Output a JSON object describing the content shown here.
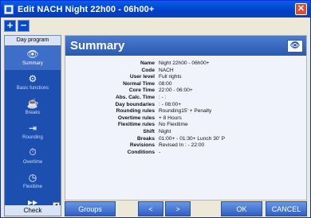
{
  "window": {
    "title": "Edit NACH Night 22h00 - 06h00+",
    "close_label": "✕"
  },
  "toolbar": {
    "add_label": "+",
    "remove_label": "−"
  },
  "sidebar": {
    "header": "Day program",
    "items": [
      {
        "label": "Summary",
        "icon": "eye-icon",
        "glyph": "👁"
      },
      {
        "label": "Basic functions",
        "icon": "basic-functions-icon",
        "glyph": "⚙"
      },
      {
        "label": "Breaks",
        "icon": "cup-icon",
        "glyph": "☕"
      },
      {
        "label": "Rounding",
        "icon": "rounding-icon",
        "glyph": "⇥"
      },
      {
        "label": "Overtime",
        "icon": "overtime-icon",
        "glyph": "⏱"
      },
      {
        "label": "Flexitime",
        "icon": "clock-icon",
        "glyph": "◷"
      },
      {
        "label": "Check",
        "icon": "check-icon",
        "glyph": "▸▸"
      }
    ],
    "scroll_glyph": "◂"
  },
  "main": {
    "title": "Summary",
    "eye_glyph": "👁",
    "properties": [
      {
        "key": "Name",
        "value": "Night 22h00 - 06h00+"
      },
      {
        "key": "Code",
        "value": "NACH"
      },
      {
        "key": "User level",
        "value": "Full rights"
      },
      {
        "key": "Normal Time",
        "value": "08:00"
      },
      {
        "key": "Core Time",
        "value": "22:00 - 06:00+"
      },
      {
        "key": "Abs. Calc. Time",
        "value": ":  -  :"
      },
      {
        "key": "Day boundaries",
        "value": ":  - 08:00+"
      },
      {
        "key": "Rounding rules",
        "value": "Rounding15' + Penalty"
      },
      {
        "key": "Overtime rules",
        "value": "+ 8 Hours"
      },
      {
        "key": "Flexitime rules",
        "value": "No Flexitime"
      },
      {
        "key": "Shift",
        "value": "Night"
      },
      {
        "key": "Breaks",
        "value": "01:00+ - 01:30+ Lunch 30' P"
      },
      {
        "key": "Revisions",
        "value": "Revised In  :  - 22:00"
      },
      {
        "key": "Conditions",
        "value": "-"
      }
    ]
  },
  "buttons": {
    "groups": "Groups",
    "prev": "<",
    "next": ">",
    "ok": "OK",
    "cancel": "CANCEL"
  }
}
